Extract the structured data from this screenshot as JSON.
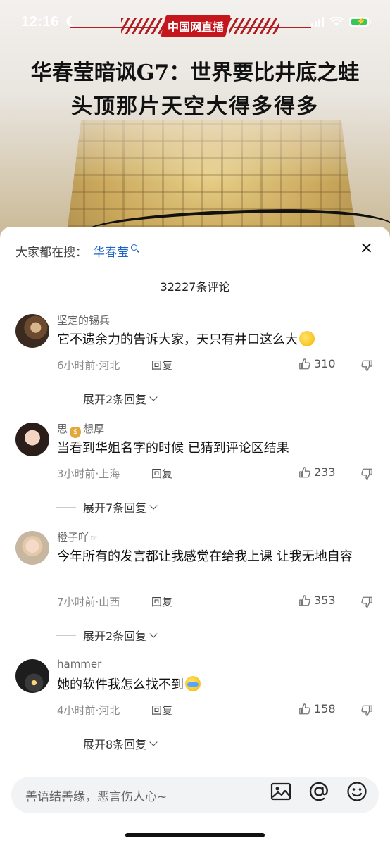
{
  "status_bar": {
    "time": "12:16"
  },
  "video": {
    "watermark": "中国网直播",
    "headline_line1": "华春莹暗讽G7：世界要比井底之蛙",
    "headline_line2": "头顶那片天空大得多得多"
  },
  "sheet": {
    "trending_label": "大家都在搜：",
    "trending_term": "华春莹",
    "comment_count": "32227条评论",
    "input_placeholder": "善语结善缘，恶言伤人心~"
  },
  "comments": [
    {
      "user": "坚定的锡兵",
      "text": "它不遗余力的告诉大家，天只有井口这么大",
      "emoji": "smirk-emoji",
      "time_location": "6小时前·河北",
      "reply": "回复",
      "likes": "310",
      "expand": "展开2条回复"
    },
    {
      "user_a": "思",
      "user_b": "想厚",
      "user_emoji": "money-bag-emoji",
      "text": "当看到华姐名字的时候 已猜到评论区结果",
      "time_location": "3小时前·上海",
      "reply": "回复",
      "likes": "233",
      "expand": "展开7条回复"
    },
    {
      "user": "橙子吖",
      "user_emoji": "pointing-hand-emoji",
      "text": "今年所有的发言都让我感觉在给我上课 让我无地自容",
      "time_location": "7小时前·山西",
      "reply": "回复",
      "likes": "353",
      "expand": "展开2条回复"
    },
    {
      "user": "hammer",
      "text": "她的软件我怎么找不到",
      "emoji": "crying-emoji",
      "time_location": "4小时前·河北",
      "reply": "回复",
      "likes": "158",
      "expand": "展开8条回复"
    }
  ],
  "colors": {
    "link_blue": "#1f66c4",
    "brand_red": "#c4161c",
    "battery_green": "#36c759"
  }
}
